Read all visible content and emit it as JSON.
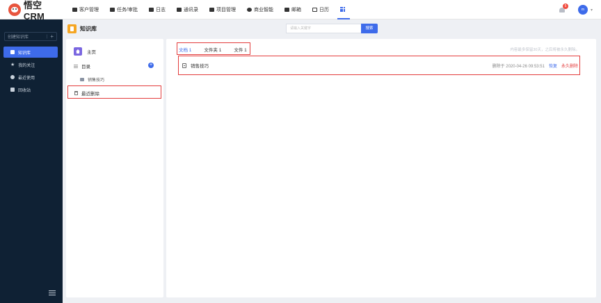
{
  "app": {
    "logo_text": "悟空CRM"
  },
  "nav": [
    {
      "label": "客户管理"
    },
    {
      "label": "任务/审批"
    },
    {
      "label": "日志"
    },
    {
      "label": "通讯录"
    },
    {
      "label": "项目管理"
    },
    {
      "label": "商业智能"
    },
    {
      "label": "邮箱"
    },
    {
      "label": "日历"
    }
  ],
  "header_right": {
    "notification_count": "5",
    "avatar_text": "m"
  },
  "sidebar": {
    "create_label": "创建知识库",
    "items": [
      {
        "label": "知识库",
        "icon": "book-icon",
        "active": true
      },
      {
        "label": "我的关注",
        "icon": "star-icon"
      },
      {
        "label": "最近使用",
        "icon": "clock-icon"
      },
      {
        "label": "回收站",
        "icon": "trash-icon"
      }
    ]
  },
  "page": {
    "title": "知识库",
    "search_placeholder": "请输入关键字",
    "search_button": "搜索"
  },
  "tree": {
    "home": "主页",
    "catalog": "目录",
    "folder": "销售技巧",
    "recent_deleted": "最近删除"
  },
  "main": {
    "tabs": [
      {
        "label": "文档 1",
        "active": true
      },
      {
        "label": "文件夹 1"
      },
      {
        "label": "文件 1"
      }
    ],
    "notice": "内容最多保留30天，之后将被永久删除。",
    "rows": [
      {
        "name": "销售技巧",
        "deleted_at": "删除于 2020-04-26 09:53:51",
        "restore_label": "恢复",
        "delete_label": "永久删除"
      }
    ]
  },
  "colors": {
    "accent": "#3e6bea",
    "sidebar_bg": "#0f2134",
    "highlight": "#e33b3b"
  }
}
